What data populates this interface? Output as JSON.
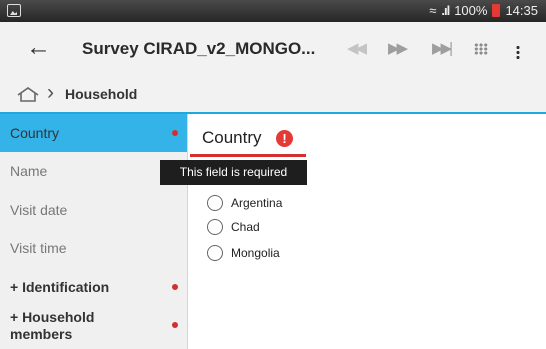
{
  "status_bar": {
    "signal": ".ıl",
    "battery": "100%",
    "time": "14:35"
  },
  "toolbar": {
    "back_icon": "arrow-left-icon",
    "title": "Survey CIRAD_v2_MONGO...",
    "icons": [
      "rewind-icon",
      "fast-forward-icon",
      "skip-end-icon",
      "grid-icon",
      "more-vert-icon"
    ]
  },
  "breadcrumb": {
    "home_icon": "home-icon",
    "section": "Household"
  },
  "sidebar": {
    "items": [
      {
        "label": "Country",
        "active": true,
        "required": true
      },
      {
        "label": "Name"
      },
      {
        "label": "Visit date"
      },
      {
        "label": "Visit time"
      },
      {
        "label": "+ Identification",
        "required": true
      },
      {
        "label": "+ Household members",
        "required": true
      }
    ]
  },
  "question": {
    "label": "Country",
    "error": "This field is required",
    "options": [
      "Argentina",
      "Chad",
      "Mongolia"
    ]
  },
  "colors": {
    "accent": "#34b3e8",
    "error": "#d32f2f"
  }
}
